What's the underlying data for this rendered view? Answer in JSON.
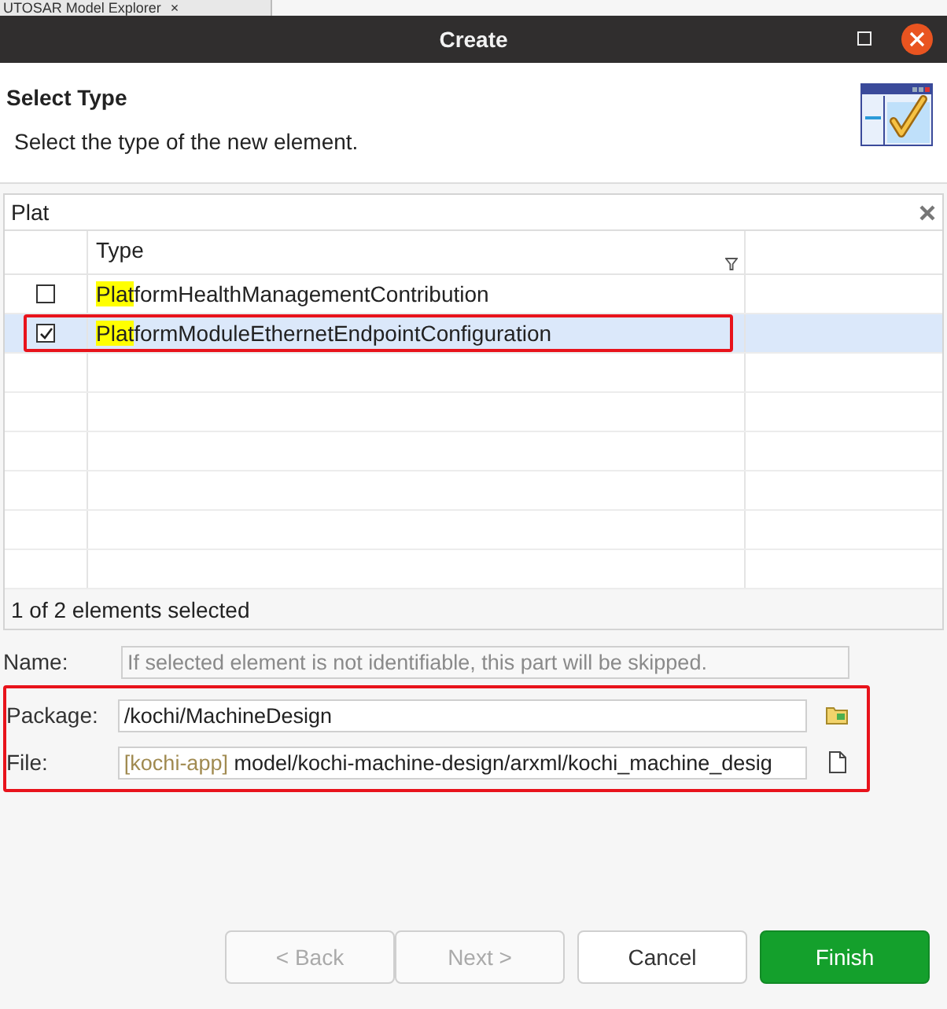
{
  "background_tab": {
    "title": "UTOSAR Model Explorer",
    "close": "×"
  },
  "window": {
    "title": "Create"
  },
  "header": {
    "title": "Select Type",
    "description": "Select the type of the new element."
  },
  "filter": {
    "value": "Plat"
  },
  "table": {
    "columns": [
      "Type"
    ],
    "rows": [
      {
        "highlight": "Plat",
        "rest": "formHealthManagementContribution",
        "checked": false,
        "selected": false,
        "annotated": false
      },
      {
        "highlight": "Plat",
        "rest": "formModuleEthernetEndpointConfiguration",
        "checked": true,
        "selected": true,
        "annotated": true
      }
    ]
  },
  "status": "1 of 2 elements selected",
  "fields": {
    "name": {
      "label": "Name:",
      "placeholder": "If selected element is not identifiable, this part will be skipped."
    },
    "package": {
      "label": "Package:",
      "value": "/kochi/MachineDesign"
    },
    "file": {
      "label": "File:",
      "project": "[kochi-app]",
      "path": "model/kochi-machine-design/arxml/kochi_machine_desig"
    },
    "annotated": true
  },
  "buttons": [
    {
      "label": "< Back",
      "kind": "normal",
      "disabled": true
    },
    {
      "label": "Next >",
      "kind": "normal",
      "disabled": true
    },
    {
      "label": "Cancel",
      "kind": "normal",
      "disabled": false
    },
    {
      "label": "Finish",
      "kind": "primary",
      "disabled": false
    }
  ]
}
